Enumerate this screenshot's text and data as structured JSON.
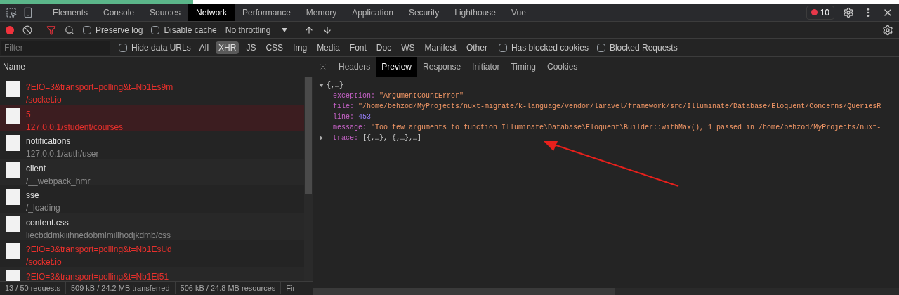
{
  "main_tabs": [
    {
      "label": "Elements",
      "selected": false
    },
    {
      "label": "Console",
      "selected": false
    },
    {
      "label": "Sources",
      "selected": false
    },
    {
      "label": "Network",
      "selected": true
    },
    {
      "label": "Performance",
      "selected": false
    },
    {
      "label": "Memory",
      "selected": false
    },
    {
      "label": "Application",
      "selected": false
    },
    {
      "label": "Security",
      "selected": false
    },
    {
      "label": "Lighthouse",
      "selected": false
    },
    {
      "label": "Vue",
      "selected": false
    }
  ],
  "error_count": "10",
  "toolbar": {
    "recording": true,
    "preserve_log": {
      "label": "Preserve log",
      "checked": false
    },
    "disable_cache": {
      "label": "Disable cache",
      "checked": false
    },
    "throttling": "No throttling"
  },
  "filter_bar": {
    "placeholder": "Filter",
    "hide_data_urls": {
      "label": "Hide data URLs",
      "checked": false
    },
    "types": [
      {
        "label": "All",
        "selected": false
      },
      {
        "label": "XHR",
        "selected": true
      },
      {
        "label": "JS",
        "selected": false
      },
      {
        "label": "CSS",
        "selected": false
      },
      {
        "label": "Img",
        "selected": false
      },
      {
        "label": "Media",
        "selected": false
      },
      {
        "label": "Font",
        "selected": false
      },
      {
        "label": "Doc",
        "selected": false
      },
      {
        "label": "WS",
        "selected": false
      },
      {
        "label": "Manifest",
        "selected": false
      },
      {
        "label": "Other",
        "selected": false
      }
    ],
    "blocked_cookies": {
      "label": "Has blocked cookies",
      "checked": false
    },
    "blocked_requests": {
      "label": "Blocked Requests",
      "checked": false
    }
  },
  "requests": {
    "column": "Name",
    "rows": [
      {
        "name": "?EIO=3&transport=polling&t=Nb1Es9m",
        "path": "/socket.io",
        "failed": true,
        "selected": false
      },
      {
        "name": "5",
        "path": "127.0.0.1/student/courses",
        "failed": true,
        "selected": true
      },
      {
        "name": "notifications",
        "path": "127.0.0.1/auth/user",
        "failed": false,
        "selected": false
      },
      {
        "name": "client",
        "path": "/__webpack_hmr",
        "failed": false,
        "selected": false
      },
      {
        "name": "sse",
        "path": "/_loading",
        "failed": false,
        "selected": false
      },
      {
        "name": "content.css",
        "path": "liecbddmkiiihnedobmlmillhodjkdmb/css",
        "failed": false,
        "selected": false
      },
      {
        "name": "?EIO=3&transport=polling&t=Nb1EsUd",
        "path": "/socket.io",
        "failed": true,
        "selected": false
      },
      {
        "name": "?EIO=3&transport=polling&t=Nb1Et51",
        "failed": true,
        "selected": false
      }
    ]
  },
  "status_bar": [
    "13 / 50 requests",
    "509 kB / 24.2 MB transferred",
    "506 kB / 24.8 MB resources",
    "Fir"
  ],
  "detail_tabs": [
    {
      "label": "Headers",
      "selected": false
    },
    {
      "label": "Preview",
      "selected": true
    },
    {
      "label": "Response",
      "selected": false
    },
    {
      "label": "Initiator",
      "selected": false
    },
    {
      "label": "Timing",
      "selected": false
    },
    {
      "label": "Cookies",
      "selected": false
    }
  ],
  "preview": {
    "root": "{,…}",
    "expanded": true,
    "properties": [
      {
        "key": "exception:",
        "value": "\"ArgumentCountError\"",
        "kind": "string"
      },
      {
        "key": "file:",
        "value": "\"/home/behzod/MyProjects/nuxt-migrate/k-language/vendor/laravel/framework/src/Illuminate/Database/Eloquent/Concerns/QueriesR",
        "kind": "string"
      },
      {
        "key": "line:",
        "value": "453",
        "kind": "number"
      },
      {
        "key": "message:",
        "value": "\"Too few arguments to function Illuminate\\Database\\Eloquent\\Builder::withMax(), 1 passed in /home/behzod/MyProjects/nuxt-",
        "kind": "string"
      },
      {
        "key": "trace:",
        "value": "[{,…}, {,…},…]",
        "kind": "array",
        "expanded": false
      }
    ]
  }
}
